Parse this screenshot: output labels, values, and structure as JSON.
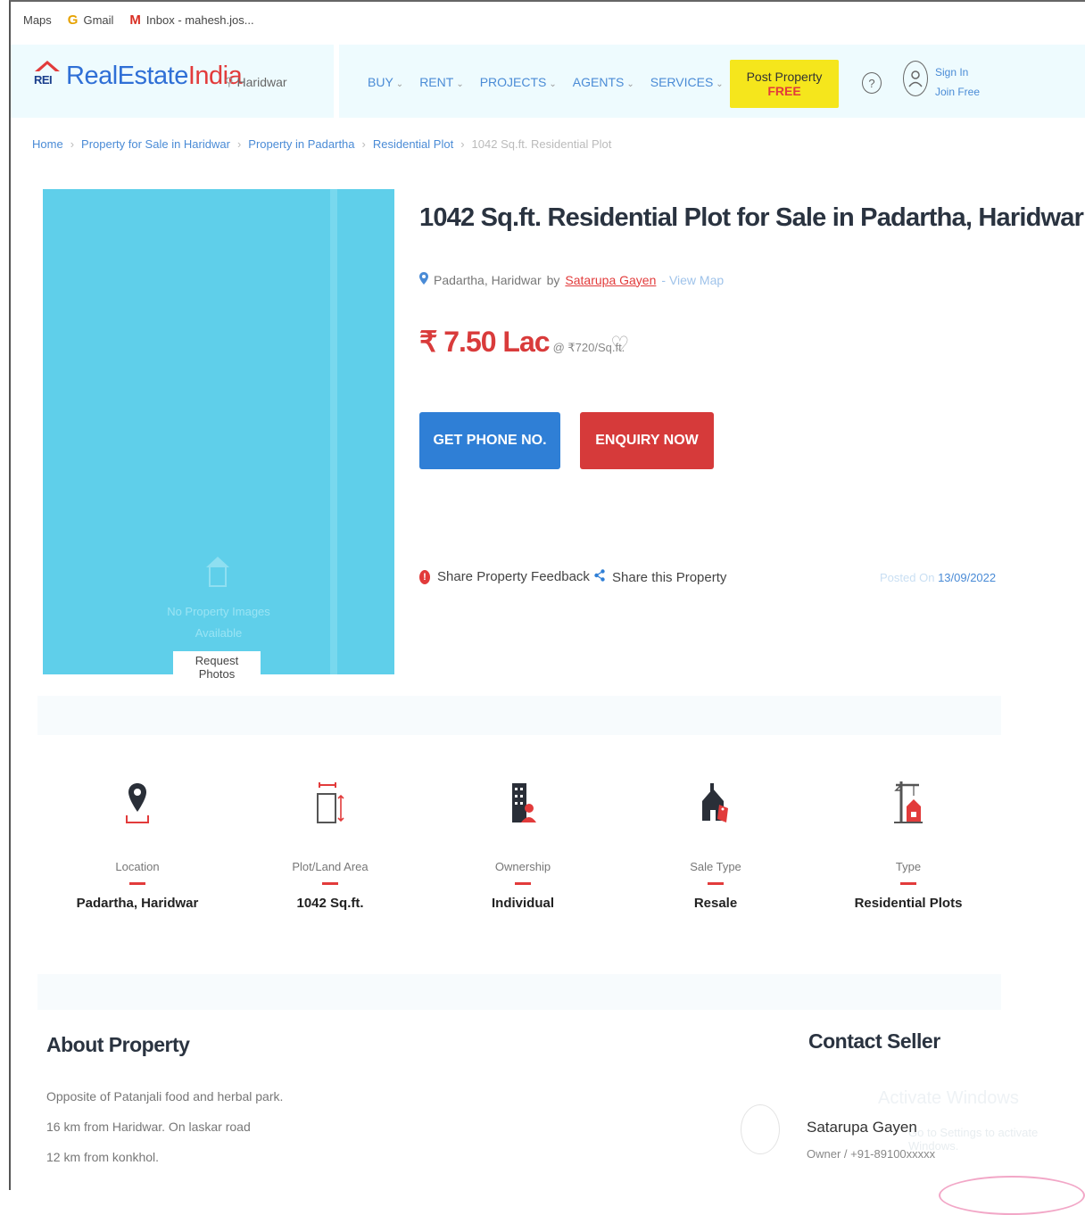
{
  "bookmarks": [
    {
      "icon": "",
      "label": "Maps"
    },
    {
      "icon": "G",
      "label": "Gmail"
    },
    {
      "icon": "M",
      "label": "Inbox - mahesh.jos..."
    }
  ],
  "header": {
    "logo_rei": "REI",
    "logo_real_estate": "RealEstate",
    "logo_india": "India",
    "city": "Haridwar",
    "nav": [
      "BUY",
      "RENT",
      "PROJECTS",
      "AGENTS",
      "SERVICES"
    ],
    "post_property": "Post Property",
    "post_free": "FREE",
    "help": "?",
    "sign_in": "Sign In",
    "join_free": "Join Free"
  },
  "breadcrumb": {
    "items": [
      "Home",
      "Property for Sale in Haridwar",
      "Property in Padartha",
      "Residential Plot"
    ],
    "current": "1042 Sq.ft. Residential Plot"
  },
  "photo": {
    "no_images_line1": "No Property Images",
    "no_images_line2": "Available",
    "request_photos": "Request Photos"
  },
  "property": {
    "title": "1042 Sq.ft. Residential Plot for Sale in Padartha, Haridwar",
    "location": "Padartha, Haridwar",
    "by": "by",
    "seller": "Satarupa Gayen",
    "view_map": "- View Map",
    "price": "₹ 7.50 Lac",
    "rate": "@ ₹720/Sq.ft.",
    "get_phone": "GET PHONE NO.",
    "enquiry": "ENQUIRY NOW",
    "feedback": "Share Property Feedback",
    "share": "Share this Property",
    "posted_label": "Posted On",
    "posted_date": "13/09/2022"
  },
  "features": [
    {
      "icon": "location-pin-icon",
      "label": "Location",
      "value": "Padartha, Haridwar"
    },
    {
      "icon": "area-icon",
      "label": "Plot/Land Area",
      "value": "1042 Sq.ft."
    },
    {
      "icon": "ownership-icon",
      "label": "Ownership",
      "value": "Individual"
    },
    {
      "icon": "sale-tag-icon",
      "label": "Sale Type",
      "value": "Resale"
    },
    {
      "icon": "crane-icon",
      "label": "Type",
      "value": "Residential Plots"
    }
  ],
  "about": {
    "title": "About Property",
    "lines": [
      "Opposite of Patanjali food and herbal park.",
      "16 km from Haridwar. On laskar road",
      "12 km from konkhol."
    ]
  },
  "contact": {
    "title": "Contact Seller",
    "name": "Satarupa Gayen",
    "meta": "Owner / +91-89100xxxxx"
  },
  "watermark": {
    "line1": "Activate Windows",
    "line2": "Go to Settings to activate Windows."
  },
  "colors": {
    "accent_blue": "#2f7fd6",
    "accent_red": "#d63a3a",
    "post_yellow": "#f5e61c",
    "photo_cyan": "#5fcfea"
  }
}
